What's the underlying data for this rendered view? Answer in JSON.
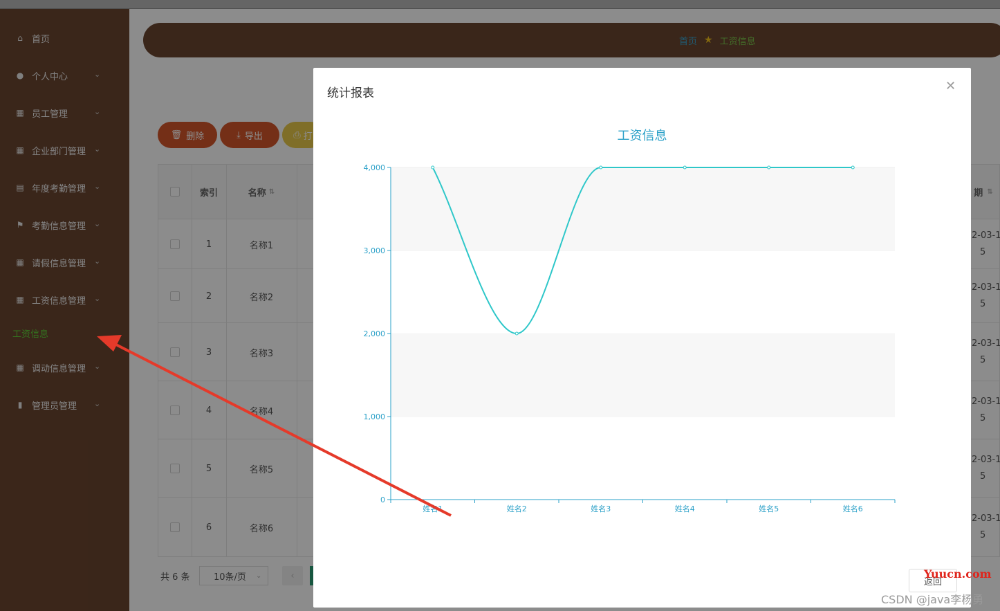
{
  "sidebar": {
    "items": [
      {
        "label": "首页",
        "icon": "home-icon",
        "has_chevron": false
      },
      {
        "label": "个人中心",
        "icon": "user-icon",
        "has_chevron": true
      },
      {
        "label": "员工管理",
        "icon": "grid-icon",
        "has_chevron": true
      },
      {
        "label": "企业部门管理",
        "icon": "grid-icon",
        "has_chevron": true
      },
      {
        "label": "年度考勤管理",
        "icon": "clipboard-icon",
        "has_chevron": true
      },
      {
        "label": "考勤信息管理",
        "icon": "flag-icon",
        "has_chevron": true
      },
      {
        "label": "请假信息管理",
        "icon": "grid-icon",
        "has_chevron": true
      },
      {
        "label": "工资信息管理",
        "icon": "grid-icon",
        "has_chevron": true
      },
      {
        "label": "调动信息管理",
        "icon": "grid-icon",
        "has_chevron": true
      },
      {
        "label": "管理员管理",
        "icon": "bar-chart-icon",
        "has_chevron": true
      }
    ],
    "active_sub": "工资信息"
  },
  "breadcrumb": {
    "home": "首页",
    "current": "工资信息"
  },
  "toolbar": {
    "delete_label": "删除",
    "export_label": "导出",
    "print_label": "打"
  },
  "table": {
    "headers": {
      "index": "索引",
      "name": "名称",
      "date_partial": "期"
    },
    "rows": [
      {
        "index": "1",
        "name": "名称1",
        "date_a": "2-03-1",
        "date_b": "5"
      },
      {
        "index": "2",
        "name": "名称2",
        "date_a": "2-03-1",
        "date_b": "5"
      },
      {
        "index": "3",
        "name": "名称3",
        "date_a": "2-03-1",
        "date_b": "5"
      },
      {
        "index": "4",
        "name": "名称4",
        "date_a": "2-03-1",
        "date_b": "5"
      },
      {
        "index": "5",
        "name": "名称5",
        "date_a": "2-03-1",
        "date_b": "5"
      },
      {
        "index": "6",
        "name": "名称6",
        "date_a": "2-03-1",
        "date_b": "5"
      }
    ]
  },
  "pager": {
    "total": "共 6 条",
    "page_size": "10条/页"
  },
  "modal": {
    "title": "统计报表",
    "back_label": "返回"
  },
  "chart_data": {
    "type": "line",
    "title": "工资信息",
    "categories": [
      "姓名1",
      "姓名2",
      "姓名3",
      "姓名4",
      "姓名5",
      "姓名6"
    ],
    "series": [
      {
        "values": [
          4000,
          2000,
          4000,
          4000,
          4000,
          4000
        ]
      }
    ],
    "ylim": [
      0,
      4000
    ],
    "yticks": [
      0,
      1000,
      2000,
      3000,
      4000
    ],
    "ytick_labels": [
      "0",
      "1,000",
      "2,000",
      "3,000",
      "4,000"
    ],
    "smooth": true,
    "line_color": "#2ec7c9",
    "axis_color": "#2aa0c8"
  },
  "watermark": {
    "site": "Yuucn.com",
    "author": "CSDN @java李杨勇"
  },
  "colors": {
    "sidebar_bg": "#6b4530",
    "active_green": "#5fcf3a",
    "accent_blue": "#2aa0c8",
    "button_orange": "#d4562b"
  }
}
